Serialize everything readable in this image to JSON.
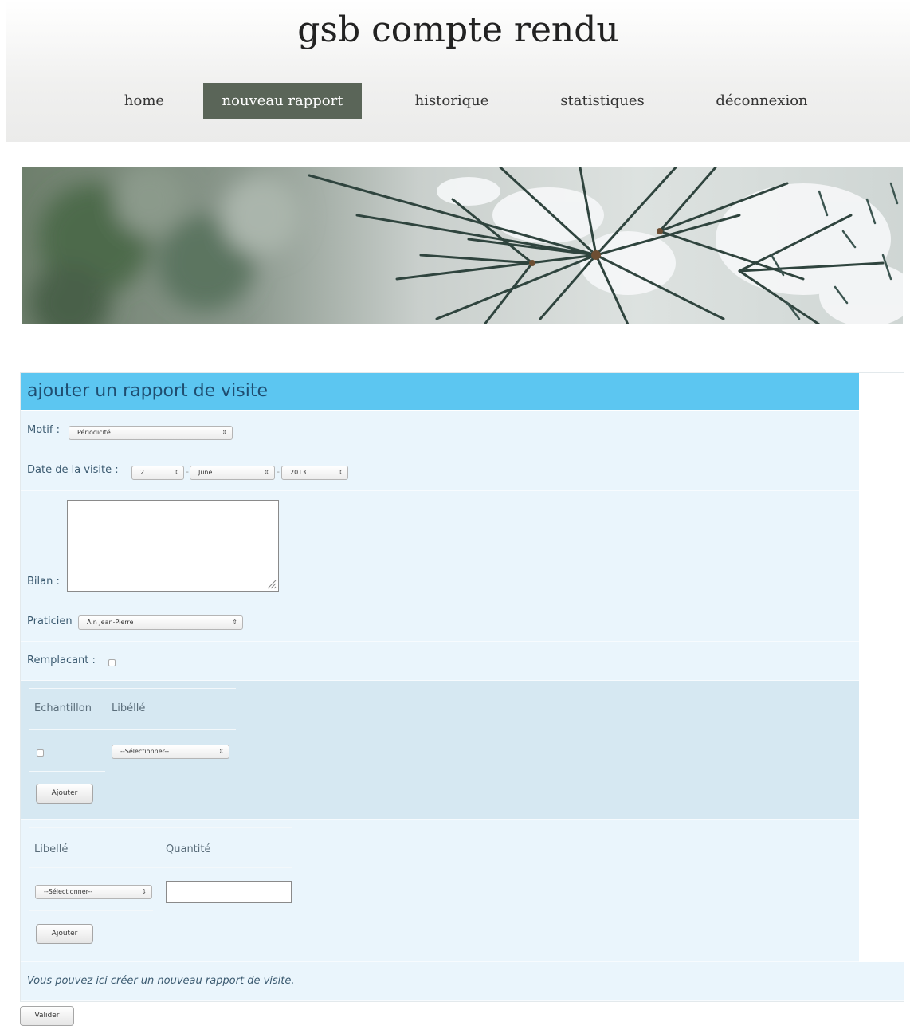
{
  "site": {
    "title": "gsb compte rendu"
  },
  "nav": [
    {
      "label": "home"
    },
    {
      "label": "nouveau rapport",
      "active": true
    },
    {
      "label": "historique"
    },
    {
      "label": "statistiques"
    },
    {
      "label": "déconnexion"
    }
  ],
  "form": {
    "title": "ajouter un rapport de visite",
    "motif": {
      "label": "Motif :",
      "value": "Périodicité"
    },
    "date": {
      "label": "Date de la visite :",
      "day": "2",
      "month": "June",
      "year": "2013",
      "separator": "-"
    },
    "bilan": {
      "label": "Bilan :"
    },
    "praticien": {
      "label": "Praticien",
      "value": "Ain Jean-Pierre"
    },
    "remplacant": {
      "label": "Remplacant :",
      "checked": false
    },
    "echantillons": {
      "col_echantillon": "Echantillon",
      "col_libelle": "Libéllé",
      "select_value": "--Sélectionner--",
      "add_label": "Ajouter"
    },
    "produits": {
      "col_libelle": "Libellé",
      "col_quantite": "Quantité",
      "select_value": "--Sélectionner--",
      "quantity_value": "",
      "add_label": "Ajouter"
    },
    "footer_note": "Vous pouvez ici créer un nouveau rapport de visite.",
    "submit_label": "Valider"
  },
  "colors": {
    "header_bar": "#5cc6f1",
    "nav_active": "#5a6558",
    "row_bg": "#eaf5fc",
    "section_bg": "#d6e8f2"
  }
}
